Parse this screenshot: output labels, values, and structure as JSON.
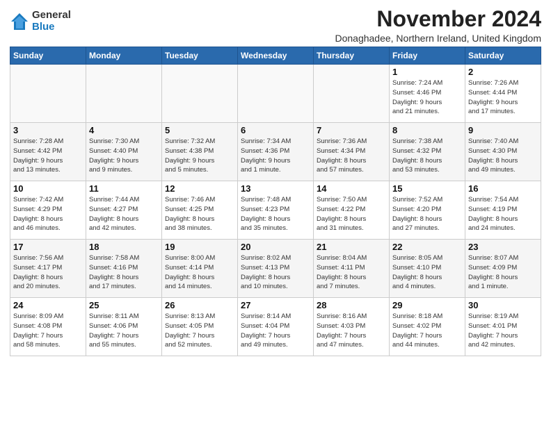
{
  "logo": {
    "general": "General",
    "blue": "Blue"
  },
  "title": "November 2024",
  "location": "Donaghadee, Northern Ireland, United Kingdom",
  "headers": [
    "Sunday",
    "Monday",
    "Tuesday",
    "Wednesday",
    "Thursday",
    "Friday",
    "Saturday"
  ],
  "weeks": [
    [
      {
        "day": "",
        "info": ""
      },
      {
        "day": "",
        "info": ""
      },
      {
        "day": "",
        "info": ""
      },
      {
        "day": "",
        "info": ""
      },
      {
        "day": "",
        "info": ""
      },
      {
        "day": "1",
        "info": "Sunrise: 7:24 AM\nSunset: 4:46 PM\nDaylight: 9 hours\nand 21 minutes."
      },
      {
        "day": "2",
        "info": "Sunrise: 7:26 AM\nSunset: 4:44 PM\nDaylight: 9 hours\nand 17 minutes."
      }
    ],
    [
      {
        "day": "3",
        "info": "Sunrise: 7:28 AM\nSunset: 4:42 PM\nDaylight: 9 hours\nand 13 minutes."
      },
      {
        "day": "4",
        "info": "Sunrise: 7:30 AM\nSunset: 4:40 PM\nDaylight: 9 hours\nand 9 minutes."
      },
      {
        "day": "5",
        "info": "Sunrise: 7:32 AM\nSunset: 4:38 PM\nDaylight: 9 hours\nand 5 minutes."
      },
      {
        "day": "6",
        "info": "Sunrise: 7:34 AM\nSunset: 4:36 PM\nDaylight: 9 hours\nand 1 minute."
      },
      {
        "day": "7",
        "info": "Sunrise: 7:36 AM\nSunset: 4:34 PM\nDaylight: 8 hours\nand 57 minutes."
      },
      {
        "day": "8",
        "info": "Sunrise: 7:38 AM\nSunset: 4:32 PM\nDaylight: 8 hours\nand 53 minutes."
      },
      {
        "day": "9",
        "info": "Sunrise: 7:40 AM\nSunset: 4:30 PM\nDaylight: 8 hours\nand 49 minutes."
      }
    ],
    [
      {
        "day": "10",
        "info": "Sunrise: 7:42 AM\nSunset: 4:29 PM\nDaylight: 8 hours\nand 46 minutes."
      },
      {
        "day": "11",
        "info": "Sunrise: 7:44 AM\nSunset: 4:27 PM\nDaylight: 8 hours\nand 42 minutes."
      },
      {
        "day": "12",
        "info": "Sunrise: 7:46 AM\nSunset: 4:25 PM\nDaylight: 8 hours\nand 38 minutes."
      },
      {
        "day": "13",
        "info": "Sunrise: 7:48 AM\nSunset: 4:23 PM\nDaylight: 8 hours\nand 35 minutes."
      },
      {
        "day": "14",
        "info": "Sunrise: 7:50 AM\nSunset: 4:22 PM\nDaylight: 8 hours\nand 31 minutes."
      },
      {
        "day": "15",
        "info": "Sunrise: 7:52 AM\nSunset: 4:20 PM\nDaylight: 8 hours\nand 27 minutes."
      },
      {
        "day": "16",
        "info": "Sunrise: 7:54 AM\nSunset: 4:19 PM\nDaylight: 8 hours\nand 24 minutes."
      }
    ],
    [
      {
        "day": "17",
        "info": "Sunrise: 7:56 AM\nSunset: 4:17 PM\nDaylight: 8 hours\nand 20 minutes."
      },
      {
        "day": "18",
        "info": "Sunrise: 7:58 AM\nSunset: 4:16 PM\nDaylight: 8 hours\nand 17 minutes."
      },
      {
        "day": "19",
        "info": "Sunrise: 8:00 AM\nSunset: 4:14 PM\nDaylight: 8 hours\nand 14 minutes."
      },
      {
        "day": "20",
        "info": "Sunrise: 8:02 AM\nSunset: 4:13 PM\nDaylight: 8 hours\nand 10 minutes."
      },
      {
        "day": "21",
        "info": "Sunrise: 8:04 AM\nSunset: 4:11 PM\nDaylight: 8 hours\nand 7 minutes."
      },
      {
        "day": "22",
        "info": "Sunrise: 8:05 AM\nSunset: 4:10 PM\nDaylight: 8 hours\nand 4 minutes."
      },
      {
        "day": "23",
        "info": "Sunrise: 8:07 AM\nSunset: 4:09 PM\nDaylight: 8 hours\nand 1 minute."
      }
    ],
    [
      {
        "day": "24",
        "info": "Sunrise: 8:09 AM\nSunset: 4:08 PM\nDaylight: 7 hours\nand 58 minutes."
      },
      {
        "day": "25",
        "info": "Sunrise: 8:11 AM\nSunset: 4:06 PM\nDaylight: 7 hours\nand 55 minutes."
      },
      {
        "day": "26",
        "info": "Sunrise: 8:13 AM\nSunset: 4:05 PM\nDaylight: 7 hours\nand 52 minutes."
      },
      {
        "day": "27",
        "info": "Sunrise: 8:14 AM\nSunset: 4:04 PM\nDaylight: 7 hours\nand 49 minutes."
      },
      {
        "day": "28",
        "info": "Sunrise: 8:16 AM\nSunset: 4:03 PM\nDaylight: 7 hours\nand 47 minutes."
      },
      {
        "day": "29",
        "info": "Sunrise: 8:18 AM\nSunset: 4:02 PM\nDaylight: 7 hours\nand 44 minutes."
      },
      {
        "day": "30",
        "info": "Sunrise: 8:19 AM\nSunset: 4:01 PM\nDaylight: 7 hours\nand 42 minutes."
      }
    ]
  ]
}
